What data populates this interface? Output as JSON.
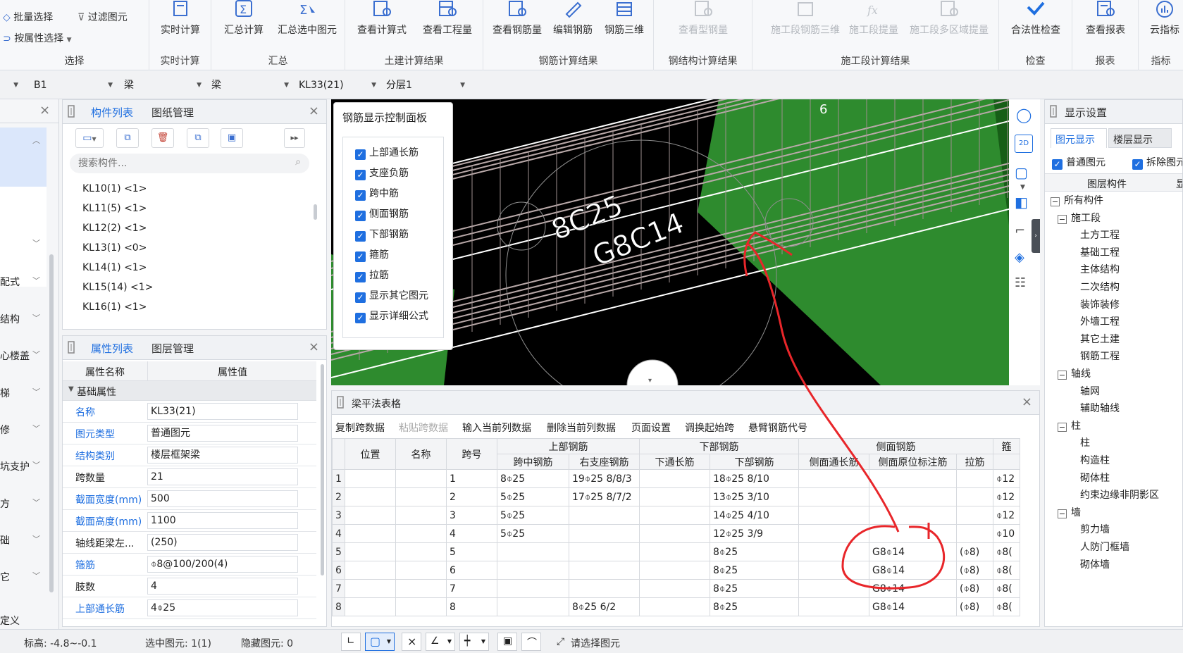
{
  "ribbon": {
    "select_group": {
      "title": "选择",
      "items": [
        "批量选择",
        "按属性选择",
        "过滤图元"
      ]
    },
    "groups": [
      {
        "title": "实时计算",
        "buttons": [
          {
            "label": "实时计算",
            "enabled": true
          }
        ]
      },
      {
        "title": "汇总",
        "buttons": [
          {
            "label": "汇总计算",
            "enabled": true
          },
          {
            "label": "汇总选中图元",
            "enabled": true
          }
        ]
      },
      {
        "title": "土建计算结果",
        "buttons": [
          {
            "label": "查看计算式",
            "enabled": true
          },
          {
            "label": "查看工程量",
            "enabled": true
          }
        ]
      },
      {
        "title": "钢筋计算结果",
        "buttons": [
          {
            "label": "查看钢筋量",
            "enabled": true
          },
          {
            "label": "编辑钢筋",
            "enabled": true
          },
          {
            "label": "钢筋三维",
            "enabled": true
          }
        ]
      },
      {
        "title": "钢结构计算结果",
        "buttons": [
          {
            "label": "查看型钢量",
            "enabled": false
          }
        ]
      },
      {
        "title": "施工段计算结果",
        "buttons": [
          {
            "label": "施工段钢筋三维",
            "enabled": false
          },
          {
            "label": "施工段提量",
            "enabled": false
          },
          {
            "label": "施工段多区域提量",
            "enabled": false
          }
        ]
      },
      {
        "title": "检查",
        "buttons": [
          {
            "label": "合法性检查",
            "enabled": true
          }
        ]
      },
      {
        "title": "报表",
        "buttons": [
          {
            "label": "查看报表",
            "enabled": true
          }
        ]
      },
      {
        "title": "指标",
        "buttons": [
          {
            "label": "云指标",
            "enabled": true
          }
        ]
      }
    ]
  },
  "toolbar2": {
    "floor": "B1",
    "type1": "梁",
    "type2": "梁",
    "component": "KL33(21)",
    "layer": "分层1"
  },
  "left_strip": {
    "items": [
      "配式",
      "结构",
      "心楼盖",
      "梯",
      "修",
      "坑支护",
      "方",
      "础",
      "它",
      "定义"
    ]
  },
  "component_list": {
    "tabs": [
      "构件列表",
      "图纸管理"
    ],
    "search_placeholder": "搜索构件...",
    "items": [
      "KL10(1) <1>",
      "KL11(5) <1>",
      "KL12(2) <1>",
      "KL13(1) <0>",
      "KL14(1) <1>",
      "KL15(14) <1>",
      "KL16(1) <1>"
    ]
  },
  "properties": {
    "tabs": [
      "属性列表",
      "图层管理"
    ],
    "header": {
      "name": "属性名称",
      "value": "属性值"
    },
    "section": "基础属性",
    "rows": [
      {
        "name": "名称",
        "value": "KL33(21)",
        "blue": true
      },
      {
        "name": "图元类型",
        "value": "普通图元",
        "blue": true
      },
      {
        "name": "结构类别",
        "value": "楼层框架梁",
        "blue": true
      },
      {
        "name": "跨数量",
        "value": "21",
        "blue": false
      },
      {
        "name": "截面宽度(mm)",
        "value": "500",
        "blue": true
      },
      {
        "name": "截面高度(mm)",
        "value": "1100",
        "blue": true
      },
      {
        "name": "轴线距梁左...",
        "value": "(250)",
        "blue": false
      },
      {
        "name": "箍筋",
        "value": "⌽8@100/200(4)",
        "blue": true
      },
      {
        "name": "肢数",
        "value": "4",
        "blue": false
      },
      {
        "name": "上部通长筋",
        "value": "4⌽25",
        "blue": true
      }
    ]
  },
  "rebar_control": {
    "title": "钢筋显示控制面板",
    "options": [
      "上部通长筋",
      "支座负筋",
      "跨中筋",
      "侧面钢筋",
      "下部钢筋",
      "箍筋",
      "拉筋",
      "显示其它图元",
      "显示详细公式"
    ]
  },
  "viewport": {
    "label_top": "8C25",
    "label_bottom": "G8C14",
    "axis_number": "6"
  },
  "beam_table": {
    "title": "梁平法表格",
    "actions": [
      {
        "label": "复制跨数据",
        "enabled": true
      },
      {
        "label": "粘贴跨数据",
        "enabled": false
      },
      {
        "label": "输入当前列数据",
        "enabled": true
      },
      {
        "label": "删除当前列数据",
        "enabled": true
      },
      {
        "label": "页面设置",
        "enabled": true
      },
      {
        "label": "调换起始跨",
        "enabled": true
      },
      {
        "label": "悬臂钢筋代号",
        "enabled": true
      }
    ],
    "group_headers": {
      "position": "位置",
      "name": "名称",
      "span": "跨号",
      "top": "上部钢筋",
      "bottom": "下部钢筋",
      "side": "侧面钢筋",
      "stirrup": "箍"
    },
    "sub_headers": [
      "跨中钢筋",
      "右支座钢筋",
      "下通长筋",
      "下部钢筋",
      "侧面通长筋",
      "侧面原位标注筋",
      "拉筋"
    ],
    "rows": [
      {
        "n": "1",
        "span": "1",
        "mid": "8⌽25",
        "right": "19⌽25 8/8/3",
        "bottom_through": "",
        "bottom": "18⌽25 8/10",
        "side_through": "",
        "side": "",
        "tie": "",
        "stirrup": "⌽12"
      },
      {
        "n": "2",
        "span": "2",
        "mid": "5⌽25",
        "right": "17⌽25 8/7/2",
        "bottom_through": "",
        "bottom": "13⌽25 3/10",
        "side_through": "",
        "side": "",
        "tie": "",
        "stirrup": "⌽12"
      },
      {
        "n": "3",
        "span": "3",
        "mid": "5⌽25",
        "right": "",
        "bottom_through": "",
        "bottom": "14⌽25 4/10",
        "side_through": "",
        "side": "",
        "tie": "",
        "stirrup": "⌽12"
      },
      {
        "n": "4",
        "span": "4",
        "mid": "5⌽25",
        "right": "",
        "bottom_through": "",
        "bottom": "12⌽25 3/9",
        "side_through": "",
        "side": "",
        "tie": "",
        "stirrup": "⌽10"
      },
      {
        "n": "5",
        "span": "5",
        "mid": "",
        "right": "",
        "bottom_through": "",
        "bottom": "8⌽25",
        "side_through": "",
        "side": "G8⌽14",
        "tie": "(⌽8)",
        "stirrup": "⌽8("
      },
      {
        "n": "6",
        "span": "6",
        "mid": "",
        "right": "",
        "bottom_through": "",
        "bottom": "8⌽25",
        "side_through": "",
        "side": "G8⌽14",
        "tie": "(⌽8)",
        "stirrup": "⌽8("
      },
      {
        "n": "7",
        "span": "7",
        "mid": "",
        "right": "",
        "bottom_through": "",
        "bottom": "8⌽25",
        "side_through": "",
        "side": "G8⌽14",
        "tie": "(⌽8)",
        "stirrup": "⌽8("
      },
      {
        "n": "8",
        "span": "8",
        "mid": "",
        "right": "8⌽25 6/2",
        "bottom_through": "",
        "bottom": "8⌽25",
        "side_through": "",
        "side": "G8⌽14",
        "tie": "(⌽8)",
        "stirrup": "⌽8("
      }
    ]
  },
  "display_settings": {
    "title": "显示设置",
    "tabs": [
      "图元显示",
      "楼层显示"
    ],
    "checks": [
      "普通图元",
      "拆除图元"
    ],
    "columns": [
      "图层构件",
      "显"
    ],
    "tree": [
      {
        "label": "所有构件",
        "level": 0,
        "box": "−"
      },
      {
        "label": "施工段",
        "level": 1,
        "box": "−"
      },
      {
        "label": "土方工程",
        "level": 2,
        "box": ""
      },
      {
        "label": "基础工程",
        "level": 2,
        "box": ""
      },
      {
        "label": "主体结构",
        "level": 2,
        "box": ""
      },
      {
        "label": "二次结构",
        "level": 2,
        "box": ""
      },
      {
        "label": "装饰装修",
        "level": 2,
        "box": ""
      },
      {
        "label": "外墙工程",
        "level": 2,
        "box": ""
      },
      {
        "label": "其它土建",
        "level": 2,
        "box": ""
      },
      {
        "label": "钢筋工程",
        "level": 2,
        "box": ""
      },
      {
        "label": "轴线",
        "level": 1,
        "box": "−"
      },
      {
        "label": "轴网",
        "level": 2,
        "box": ""
      },
      {
        "label": "辅助轴线",
        "level": 2,
        "box": ""
      },
      {
        "label": "柱",
        "level": 1,
        "box": "−"
      },
      {
        "label": "柱",
        "level": 2,
        "box": ""
      },
      {
        "label": "构造柱",
        "level": 2,
        "box": ""
      },
      {
        "label": "砌体柱",
        "level": 2,
        "box": ""
      },
      {
        "label": "约束边缘非阴影区",
        "level": 2,
        "box": ""
      },
      {
        "label": "墙",
        "level": 1,
        "box": "−"
      },
      {
        "label": "剪力墙",
        "level": 2,
        "box": ""
      },
      {
        "label": "人防门框墙",
        "level": 2,
        "box": ""
      },
      {
        "label": "砌体墙",
        "level": 2,
        "box": ""
      }
    ]
  },
  "status_bar": {
    "elevation": "标高: -4.8~-0.1",
    "selected": "选中图元: 1(1)",
    "hidden": "隐藏图元: 0",
    "hint": "请选择图元"
  },
  "colors": {
    "accent": "#1f6fe0",
    "annotation": "#e8262a",
    "slab_green": "#2e8b2e"
  }
}
